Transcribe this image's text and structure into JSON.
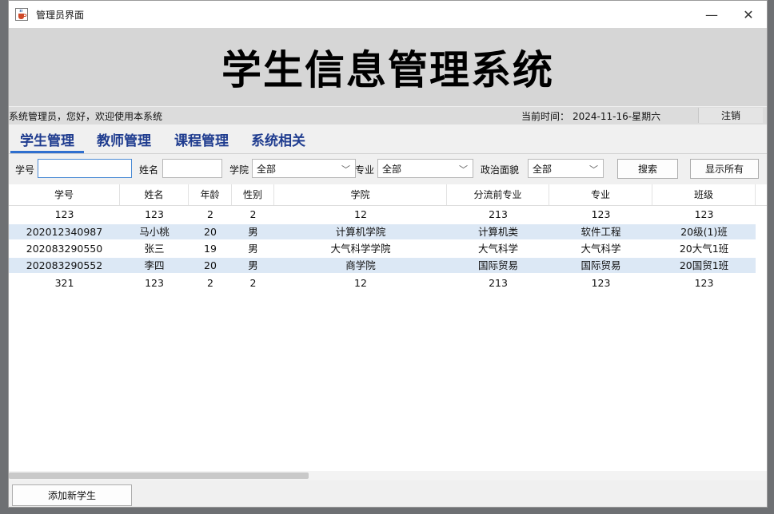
{
  "window": {
    "title": "管理员界面",
    "minimize": "—",
    "close": "✕"
  },
  "banner": {
    "title": "学生信息管理系统"
  },
  "infobar": {
    "welcome": "系统管理员，您好，欢迎使用本系统",
    "time_label": "当前时间：",
    "time_value": "2024-11-16-星期六",
    "logout": "注销"
  },
  "tabs": [
    {
      "label": "学生管理",
      "active": true
    },
    {
      "label": "教师管理"
    },
    {
      "label": "课程管理"
    },
    {
      "label": "系统相关"
    }
  ],
  "search": {
    "id_label": "学号",
    "id_value": "",
    "name_label": "姓名",
    "name_value": "",
    "college_label": "学院",
    "college_value": "全部",
    "major_label": "专业",
    "major_value": "全部",
    "political_label": "政治面貌",
    "political_value": "全部",
    "search_button": "搜索",
    "show_all_button": "显示所有"
  },
  "table": {
    "columns": [
      "学号",
      "姓名",
      "年龄",
      "性别",
      "学院",
      "分流前专业",
      "专业",
      "班级"
    ],
    "rows": [
      [
        "123",
        "123",
        "2",
        "2",
        "12",
        "213",
        "123",
        "123"
      ],
      [
        "202012340987",
        "马小桃",
        "20",
        "男",
        "计算机学院",
        "计算机类",
        "软件工程",
        "20级(1)班"
      ],
      [
        "202083290550",
        "张三",
        "19",
        "男",
        "大气科学学院",
        "大气科学",
        "大气科学",
        "20大气1班"
      ],
      [
        "202083290552",
        "李四",
        "20",
        "男",
        "商学院",
        "国际贸易",
        "国际贸易",
        "20国贸1班"
      ],
      [
        "321",
        "123",
        "2",
        "2",
        "12",
        "213",
        "123",
        "123"
      ]
    ]
  },
  "footer": {
    "add_button": "添加新学生"
  },
  "colors": {
    "tab_text": "#1f3c8f",
    "tab_underline": "#2f6fcf",
    "row_highlight": "#dce8f5",
    "banner_bg": "#d6d6d6"
  },
  "icons": {
    "app": "java-cup-icon",
    "minimize": "minimize-icon",
    "close": "close-icon",
    "dropdown": "chevron-down-icon"
  }
}
